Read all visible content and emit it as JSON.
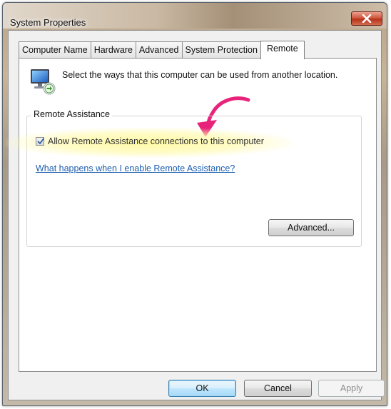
{
  "window": {
    "title": "System Properties",
    "close_glyph": "✕"
  },
  "tabs": [
    {
      "label": "Computer Name",
      "active": false
    },
    {
      "label": "Hardware",
      "active": false
    },
    {
      "label": "Advanced",
      "active": false
    },
    {
      "label": "System Protection",
      "active": false
    },
    {
      "label": "Remote",
      "active": true
    }
  ],
  "remote": {
    "intro": "Select the ways that this computer can be used from another location.",
    "icon": "computer-remote-icon",
    "annotation_color": "#e8237a",
    "remote_assistance": {
      "group_label": "Remote Assistance",
      "checkbox_label": "Allow Remote Assistance connections to this computer",
      "checkbox_checked": true,
      "help_link": "What happens when I enable Remote Assistance?",
      "advanced_button": "Advanced..."
    }
  },
  "buttons": {
    "ok": "OK",
    "cancel": "Cancel",
    "apply": "Apply"
  }
}
